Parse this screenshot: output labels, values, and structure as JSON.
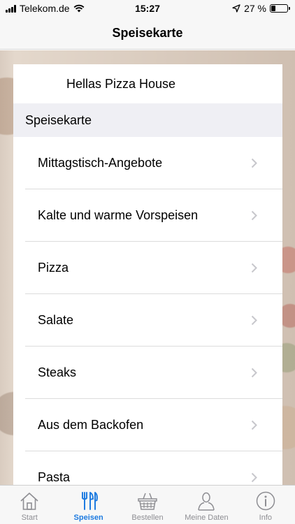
{
  "status": {
    "carrier": "Telekom.de",
    "time": "15:27",
    "battery": "27 %",
    "battery_level": 0.27,
    "icons": [
      "signal-icon",
      "wifi-icon",
      "location-arrow-icon",
      "battery-icon"
    ]
  },
  "nav": {
    "title": "Speisekarte"
  },
  "restaurant": {
    "name": "Hellas Pizza House"
  },
  "section": {
    "header": "Speisekarte"
  },
  "menu": {
    "items": [
      {
        "label": "Mittagstisch-Angebote"
      },
      {
        "label": "Kalte und warme Vorspeisen"
      },
      {
        "label": "Pizza"
      },
      {
        "label": "Salate"
      },
      {
        "label": "Steaks"
      },
      {
        "label": "Aus dem Backofen"
      },
      {
        "label": "Pasta"
      }
    ]
  },
  "tabs": [
    {
      "label": "Start",
      "icon": "home-icon"
    },
    {
      "label": "Speisen",
      "icon": "cutlery-icon",
      "active": true
    },
    {
      "label": "Bestellen",
      "icon": "basket-icon"
    },
    {
      "label": "Meine Daten",
      "icon": "user-icon"
    },
    {
      "label": "Info",
      "icon": "info-icon"
    }
  ],
  "colors": {
    "accent": "#1e7be0",
    "inactive": "#8e8e93",
    "chevron": "#c7c7cc",
    "section_bg": "#efeff4"
  }
}
